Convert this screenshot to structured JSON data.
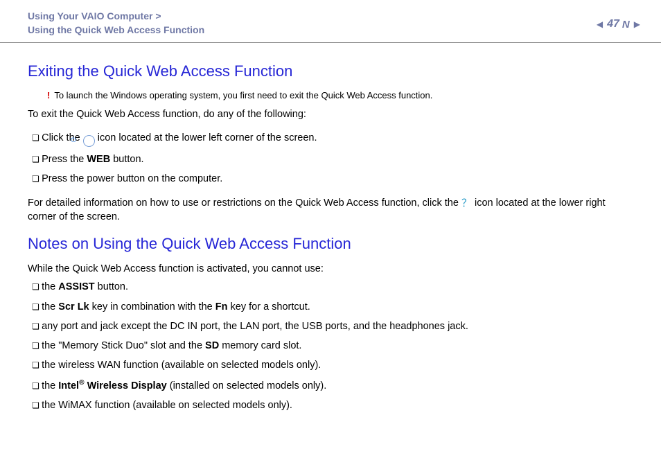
{
  "header": {
    "breadcrumb_line1_a": "Using Your VAIO Computer",
    "breadcrumb_sep": ">",
    "breadcrumb_line2": "Using the Quick Web Access Function",
    "page_number": "47",
    "n_label": "N"
  },
  "section1": {
    "title": "Exiting the Quick Web Access Function",
    "alert": "To launch the Windows operating system, you first need to exit the Quick Web Access function.",
    "intro": "To exit the Quick Web Access function, do any of the following:",
    "li1_a": "Click the ",
    "li1_b": " icon located at the lower left corner of the screen.",
    "li2_a": "Press the ",
    "li2_b": "WEB",
    "li2_c": " button.",
    "li3": "Press the power button on the computer.",
    "detail_a": "For detailed information on how to use or restrictions on the Quick Web Access function, click the ",
    "detail_b": " icon located at the lower right corner of the screen."
  },
  "section2": {
    "title": "Notes on Using the Quick Web Access Function",
    "intro": "While the Quick Web Access function is activated, you cannot use:",
    "li1_a": "the ",
    "li1_b": "ASSIST",
    "li1_c": " button.",
    "li2_a": "the ",
    "li2_b": "Scr Lk",
    "li2_c": " key in combination with the ",
    "li2_d": "Fn",
    "li2_e": " key for a shortcut.",
    "li3": "any port and jack except the DC IN port, the LAN port, the USB ports, and the headphones jack.",
    "li4_a": "the \"Memory Stick Duo\" slot and the ",
    "li4_b": "SD",
    "li4_c": " memory card slot.",
    "li5": "the wireless WAN function (available on selected models only).",
    "li6_a": "the ",
    "li6_b": "Intel",
    "li6_c": "®",
    "li6_d": " Wireless Display",
    "li6_e": " (installed on selected models only).",
    "li7": "the WiMAX function (available on selected models only)."
  }
}
